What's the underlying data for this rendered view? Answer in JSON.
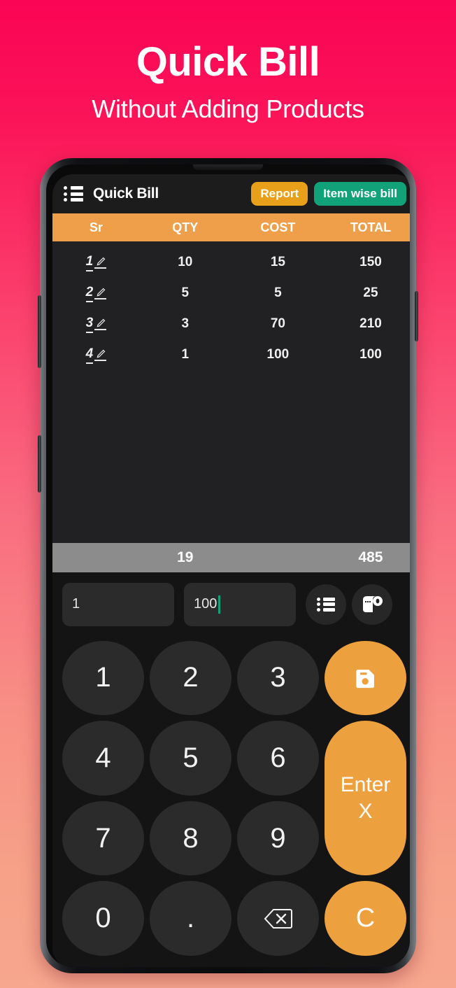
{
  "promo": {
    "title": "Quick Bill",
    "subtitle": "Without Adding Products"
  },
  "app": {
    "title": "Quick Bill",
    "menu_icon": "list-menu-icon",
    "report_button": "Report",
    "itemwise_button": "Item wise bill"
  },
  "table": {
    "headers": [
      "Sr",
      "QTY",
      "COST",
      "TOTAL"
    ],
    "rows": [
      {
        "sr": "1",
        "qty": "10",
        "cost": "15",
        "total": "150"
      },
      {
        "sr": "2",
        "qty": "5",
        "cost": "5",
        "total": "25"
      },
      {
        "sr": "3",
        "qty": "3",
        "cost": "70",
        "total": "210"
      },
      {
        "sr": "4",
        "qty": "1",
        "cost": "100",
        "total": "100"
      }
    ],
    "totals": {
      "sr": "",
      "qty": "19",
      "cost": "",
      "total": "485"
    }
  },
  "entry": {
    "qty_value": "1",
    "cost_value": "100",
    "list_icon": "bullet-list-icon",
    "receipt_icon": "receipt-roll-icon"
  },
  "keypad": {
    "k1": "1",
    "k2": "2",
    "k3": "3",
    "k4": "4",
    "k5": "5",
    "k6": "6",
    "k7": "7",
    "k8": "8",
    "k9": "9",
    "k0": "0",
    "kdot": ".",
    "backspace_icon": "backspace-icon",
    "save_icon": "floppy-save-icon",
    "enter_line1": "Enter",
    "enter_line2": "X",
    "clear": "C"
  },
  "colors": {
    "bg_top": "#fa0455",
    "bg_bottom": "#f6a188",
    "accent_orange": "#eda13e",
    "header_orange": "#ef9f49",
    "report_orange": "#e8a01b",
    "teal": "#12a279",
    "totals_gray": "#8c8c8c",
    "screen_bg": "#141415",
    "table_bg": "#212123",
    "key_bg": "#2b2b2c"
  }
}
